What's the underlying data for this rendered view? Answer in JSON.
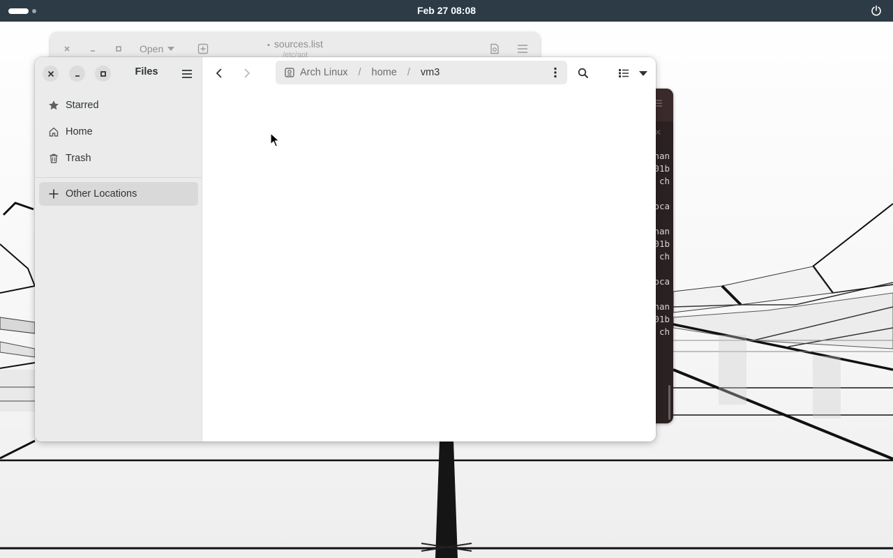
{
  "topbar": {
    "clock": "Feb 27  08:08",
    "activities_icon": "activities-pill",
    "power_icon": "power-icon"
  },
  "gedit": {
    "open_label": "Open",
    "title": "sources.list",
    "subtitle": "/etc/apt",
    "modified_marker": "•"
  },
  "terminal": {
    "visible_text": [
      "nan",
      "01b",
      "ch",
      "",
      "oca",
      "",
      "nan",
      "01b",
      "ch",
      "",
      "oca",
      "",
      "nan",
      "01b",
      "ch"
    ]
  },
  "files": {
    "title": "Files",
    "sidebar": {
      "items": [
        {
          "label": "Starred",
          "icon": "star-icon"
        },
        {
          "label": "Home",
          "icon": "home-icon"
        },
        {
          "label": "Trash",
          "icon": "trash-icon"
        }
      ],
      "other_locations": "Other Locations"
    },
    "pathbar": {
      "root": "Arch Linux",
      "separator": "/",
      "crumbs": [
        "home",
        "vm3"
      ]
    }
  },
  "colors": {
    "topbar_bg": "#2c3b45",
    "sidebar_bg": "#ebebeb",
    "terminal_bg": "#2b2122",
    "selected_bg": "#d9d9d9"
  }
}
